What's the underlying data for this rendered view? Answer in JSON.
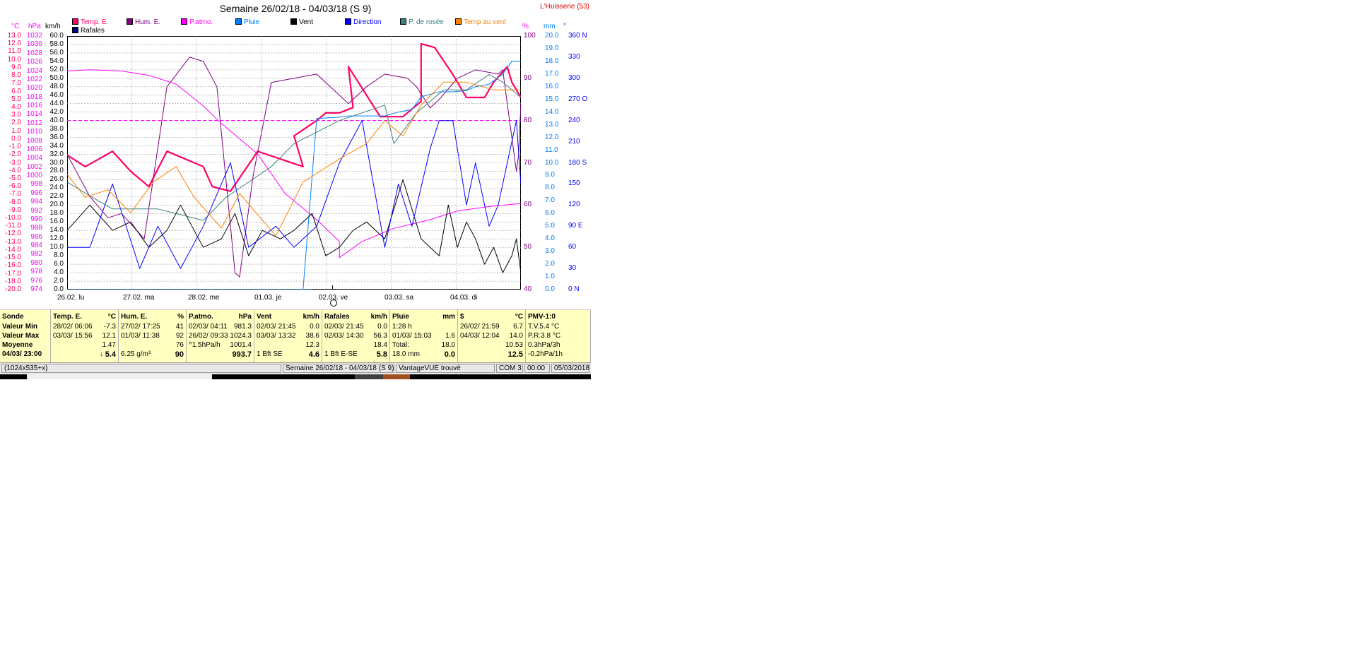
{
  "window": {
    "title": "Semaine 26/02/18 - 04/03/18 (S 9)",
    "station": "L'Huisserie (53)"
  },
  "legend": [
    {
      "label": "Temp. E.",
      "color": "#ff0066",
      "text_color": "#ff0066"
    },
    {
      "label": "Hum. E.",
      "color": "#800080",
      "text_color": "#800080"
    },
    {
      "label": "P.atmo.",
      "color": "#ff00ff",
      "text_color": "#ff00ff"
    },
    {
      "label": "Pluie",
      "color": "#0080ff",
      "text_color": "#0080ff"
    },
    {
      "label": "Vent",
      "color": "#000000",
      "text_color": "#000000"
    },
    {
      "label": "Direction",
      "color": "#0000ff",
      "text_color": "#0000ff"
    },
    {
      "label": "P. de rosée",
      "color": "#408080",
      "text_color": "#408080"
    },
    {
      "label": "Temp au vent",
      "color": "#ff8000",
      "text_color": "#ff8000"
    },
    {
      "label": "Rafales",
      "color": "#000080",
      "text_color": "#000000"
    }
  ],
  "units": {
    "temp": "°C",
    "press": "hPa",
    "wind": "km/h",
    "hum": "%",
    "rain": "mm",
    "dir": "°"
  },
  "axes": {
    "temp": [
      "13.0",
      "12.0",
      "11.0",
      "10.0",
      "9.0",
      "8.0",
      "7.0",
      "6.0",
      "5.0",
      "4.0",
      "3.0",
      "2.0",
      "1.0",
      "0.0",
      "-1.0",
      "-2.0",
      "-3.0",
      "-4.0",
      "-5.0",
      "-6.0",
      "-7.0",
      "-8.0",
      "-9.0",
      "-10.0",
      "-11.0",
      "-12.0",
      "-13.0",
      "-14.0",
      "-15.0",
      "-16.0",
      "-17.0",
      "-18.0",
      "-20.0"
    ],
    "press": [
      "1032",
      "1030",
      "1028",
      "1026",
      "1024",
      "1022",
      "1020",
      "1018",
      "1016",
      "1014",
      "1012",
      "1010",
      "1008",
      "1006",
      "1004",
      "1002",
      "1000",
      "998",
      "996",
      "994",
      "992",
      "990",
      "988",
      "986",
      "984",
      "982",
      "980",
      "978",
      "976",
      "974"
    ],
    "wind": [
      "60.0",
      "58.0",
      "56.0",
      "54.0",
      "52.0",
      "50.0",
      "48.0",
      "46.0",
      "44.0",
      "42.0",
      "40.0",
      "38.0",
      "36.0",
      "34.0",
      "32.0",
      "30.0",
      "28.0",
      "26.0",
      "24.0",
      "22.0",
      "20.0",
      "18.0",
      "16.0",
      "14.0",
      "12.0",
      "10.0",
      "8.0",
      "6.0",
      "4.0",
      "2.0",
      "0.0"
    ],
    "hum": [
      "100",
      "90",
      "80",
      "70",
      "60",
      "50",
      "40"
    ],
    "rain": [
      "20.0",
      "19.0",
      "18.0",
      "17.0",
      "16.0",
      "15.0",
      "14.0",
      "13.0",
      "12.0",
      "11.0",
      "10.0",
      "9.0",
      "8.0",
      "7.0",
      "6.0",
      "5.0",
      "4.0",
      "3.0",
      "2.0",
      "1.0",
      "0.0"
    ],
    "dir": [
      "360 N",
      "330",
      "300",
      "270 O",
      "240",
      "210",
      "180 S",
      "150",
      "120",
      "90  E",
      "60",
      "30",
      "0   N"
    ]
  },
  "x_labels": [
    "26.02.  lu",
    "27.02.  ma",
    "28.02.  me",
    "01.03.  je",
    "02.03.  ve",
    "03.03.  sa",
    "04.03.  di"
  ],
  "panel": [
    {
      "head": "Sonde",
      "unit": "",
      "rows": [
        "Valeur Min",
        "Valeur Max",
        "Moyenne",
        "04/03/ 23:00"
      ]
    },
    {
      "head": "Temp. E.",
      "unit": "°C",
      "rows": [
        [
          "28/02/  06:06",
          "-7.3"
        ],
        [
          "03/03/  15:56",
          "12.1"
        ],
        [
          "",
          "1.47"
        ],
        [
          "",
          "5.4"
        ]
      ],
      "trend": "↓"
    },
    {
      "head": "Hum. E.",
      "unit": "%",
      "rows": [
        [
          "27/02/  17:25",
          "41"
        ],
        [
          "01/03/  11:38",
          "92"
        ],
        [
          "",
          "76"
        ],
        [
          "6.25 g/m³",
          "90"
        ]
      ]
    },
    {
      "head": "P.atmo.",
      "unit": "hPa",
      "rows": [
        [
          "02/03/  04:11",
          "981.3"
        ],
        [
          "26/02/  09:33",
          "1024.3"
        ],
        [
          "^1.5hPa/h",
          "1001.4"
        ],
        [
          "",
          "993.7"
        ]
      ]
    },
    {
      "head": "Vent",
      "unit": "km/h",
      "rows": [
        [
          "02/03/  21:45",
          "0.0"
        ],
        [
          "03/03/  13:32",
          "38.6"
        ],
        [
          "",
          "12.3"
        ],
        [
          "1 Bft SE",
          "4.6"
        ]
      ]
    },
    {
      "head": "Rafales",
      "unit": "km/h",
      "rows": [
        [
          "02/03/  21:45",
          "0.0"
        ],
        [
          "02/03/  14:30",
          "56.3"
        ],
        [
          "",
          "18.4"
        ],
        [
          "1 Bft E-SE",
          "5.8"
        ]
      ]
    },
    {
      "head": "Pluie",
      "unit": "mm",
      "rows": [
        [
          "1:28 h",
          ""
        ],
        [
          "01/03/  15:03",
          "1.6"
        ],
        [
          "Total:",
          "18.0"
        ],
        [
          "18.0 mm",
          "0.0"
        ]
      ]
    },
    {
      "head": "$",
      "unit": "°C",
      "rows": [
        [
          "26/02/  21:59",
          "6.7"
        ],
        [
          "04/03/  12:04",
          "14.0"
        ],
        [
          "",
          "10.53"
        ],
        [
          "",
          "12.5"
        ]
      ]
    },
    {
      "head": "PMV-1:0",
      "unit": "",
      "rows": [
        "T.V.5.4 °C",
        "P.R.3.8 °C",
        "0.3hPa/3h",
        "-0.2hPa/1h"
      ]
    }
  ],
  "status": {
    "resolution": "(1024x535+x)",
    "period": "Semaine 26/02/18 - 04/03/18 (S 9)",
    "device": "VantageVUE trouvé",
    "port": "COM 3",
    "time": "00:00",
    "date": "05/03/2018"
  },
  "chart_data": {
    "type": "line",
    "title": "Semaine 26/02/18 - 04/03/18 (S 9)",
    "x": [
      "26.02.",
      "27.02.",
      "28.02.",
      "01.03.",
      "02.03.",
      "03.03.",
      "04.03."
    ],
    "grid": true,
    "series": [
      {
        "name": "Temp. E.",
        "axis": "°C",
        "color": "#ff0066",
        "values": [
          -2.5,
          -4.0,
          -2.0,
          -4.6,
          -6.6,
          -2.0,
          -4.0,
          -6.6,
          -7.2,
          -2.0,
          -3.0,
          -4.0,
          0.0,
          2.0,
          3.0,
          3.0,
          3.7,
          9.0,
          2.5,
          2.5,
          4.5,
          12.0,
          11.5,
          8.0,
          5.0,
          5.0,
          7.0,
          9.0,
          7.0,
          5.0
        ],
        "x_frac": [
          0,
          0.04,
          0.1,
          0.14,
          0.18,
          0.22,
          0.3,
          0.32,
          0.36,
          0.42,
          0.47,
          0.52,
          0.5,
          0.55,
          0.57,
          0.6,
          0.63,
          0.62,
          0.69,
          0.74,
          0.78,
          0.78,
          0.81,
          0.85,
          0.88,
          0.92,
          0.94,
          0.97,
          0.98,
          1.0
        ]
      },
      {
        "name": "Hum. E.",
        "axis": "%",
        "color": "#800080",
        "values": [
          72,
          62,
          57,
          58,
          52,
          88,
          95,
          94,
          88,
          44,
          43,
          67,
          89,
          90,
          91,
          86,
          84,
          88,
          91,
          90,
          88,
          83,
          85,
          90,
          92,
          91,
          92,
          68,
          72,
          84
        ],
        "x_frac": [
          0,
          0.05,
          0.09,
          0.12,
          0.17,
          0.22,
          0.27,
          0.3,
          0.33,
          0.37,
          0.38,
          0.41,
          0.45,
          0.5,
          0.55,
          0.6,
          0.62,
          0.66,
          0.7,
          0.75,
          0.77,
          0.8,
          0.82,
          0.86,
          0.9,
          0.95,
          0.96,
          0.99,
          0.995,
          1.0
        ]
      },
      {
        "name": "P.atmo.",
        "axis": "hPa",
        "color": "#ff00ff",
        "values": [
          1024,
          1024.3,
          1024,
          1023,
          1021,
          1016,
          1012,
          1005,
          996,
          990,
          985,
          981.3,
          985,
          988,
          990,
          992,
          993,
          993.7
        ],
        "x_frac": [
          0,
          0.05,
          0.12,
          0.18,
          0.24,
          0.3,
          0.34,
          0.42,
          0.48,
          0.55,
          0.6,
          0.6,
          0.65,
          0.72,
          0.8,
          0.86,
          0.93,
          1.0
        ]
      },
      {
        "name": "Pluie",
        "axis": "mm",
        "color": "#0080ff",
        "values": [
          0,
          0,
          0,
          0,
          0,
          0,
          0,
          0,
          0,
          0,
          0,
          13.5,
          13.6,
          13.7,
          13.7,
          13.7,
          14.0,
          14.2,
          15.2,
          15.6,
          15.6,
          15.7,
          16.0,
          16.2,
          17.0,
          18.0,
          18.0
        ],
        "x_frac": [
          0,
          0.1,
          0.2,
          0.3,
          0.4,
          0.45,
          0.5,
          0.52,
          0.54,
          0.5,
          0.52,
          0.55,
          0.6,
          0.62,
          0.65,
          0.7,
          0.73,
          0.76,
          0.78,
          0.82,
          0.85,
          0.88,
          0.9,
          0.93,
          0.96,
          0.98,
          1.0
        ]
      },
      {
        "name": "Vent",
        "axis": "km/h",
        "color": "#000000",
        "values": [
          14,
          20,
          14,
          16,
          10,
          14,
          20,
          10,
          12,
          18,
          8,
          14,
          12,
          14,
          18,
          8,
          10,
          14,
          16,
          12,
          26,
          12,
          8,
          20,
          10,
          16,
          12,
          6,
          10,
          4,
          8,
          12,
          4
        ],
        "x_frac": [
          0,
          0.05,
          0.1,
          0.14,
          0.18,
          0.22,
          0.25,
          0.3,
          0.34,
          0.37,
          0.4,
          0.43,
          0.47,
          0.5,
          0.54,
          0.57,
          0.6,
          0.63,
          0.66,
          0.7,
          0.74,
          0.78,
          0.82,
          0.84,
          0.86,
          0.88,
          0.9,
          0.92,
          0.94,
          0.96,
          0.98,
          0.99,
          1.0
        ]
      },
      {
        "name": "Direction",
        "axis": "°",
        "color": "#0000ff",
        "values": [
          60,
          60,
          150,
          30,
          90,
          30,
          90,
          180,
          60,
          90,
          60,
          90,
          180,
          240,
          60,
          150,
          90,
          200,
          240,
          240,
          120,
          180,
          90,
          120,
          210,
          240,
          150
        ],
        "x_frac": [
          0,
          0.05,
          0.1,
          0.16,
          0.2,
          0.25,
          0.3,
          0.36,
          0.4,
          0.46,
          0.5,
          0.55,
          0.6,
          0.65,
          0.7,
          0.73,
          0.76,
          0.8,
          0.82,
          0.85,
          0.88,
          0.9,
          0.93,
          0.95,
          0.98,
          0.99,
          1.0
        ]
      },
      {
        "name": "P. de rosée",
        "axis": "°C",
        "color": "#408080",
        "values": [
          -6.0,
          -7.8,
          -9.5,
          -9.5,
          -11.0,
          -8.0,
          -4.0,
          -1.0,
          2.0,
          3.0,
          4.0,
          -1.0,
          3.0,
          6.0,
          6.0,
          8.0,
          7.0,
          5.0
        ],
        "x_frac": [
          0,
          0.05,
          0.1,
          0.2,
          0.3,
          0.35,
          0.45,
          0.5,
          0.6,
          0.65,
          0.7,
          0.72,
          0.77,
          0.83,
          0.88,
          0.93,
          0.96,
          1.0
        ]
      },
      {
        "name": "Temp au vent",
        "axis": "°C",
        "color": "#ff8000",
        "values": [
          -5.0,
          -8.0,
          -7.0,
          -10.0,
          -6.0,
          -4.0,
          -8.0,
          -12.0,
          -7.5,
          -13.0,
          -6.0,
          -3.0,
          -1.0,
          2.0,
          0.0,
          4.0,
          7.0,
          7.0,
          6.0,
          6.0
        ],
        "x_frac": [
          0,
          0.04,
          0.09,
          0.14,
          0.19,
          0.24,
          0.28,
          0.34,
          0.38,
          0.46,
          0.52,
          0.6,
          0.66,
          0.7,
          0.74,
          0.78,
          0.83,
          0.88,
          0.94,
          1.0
        ]
      }
    ]
  }
}
